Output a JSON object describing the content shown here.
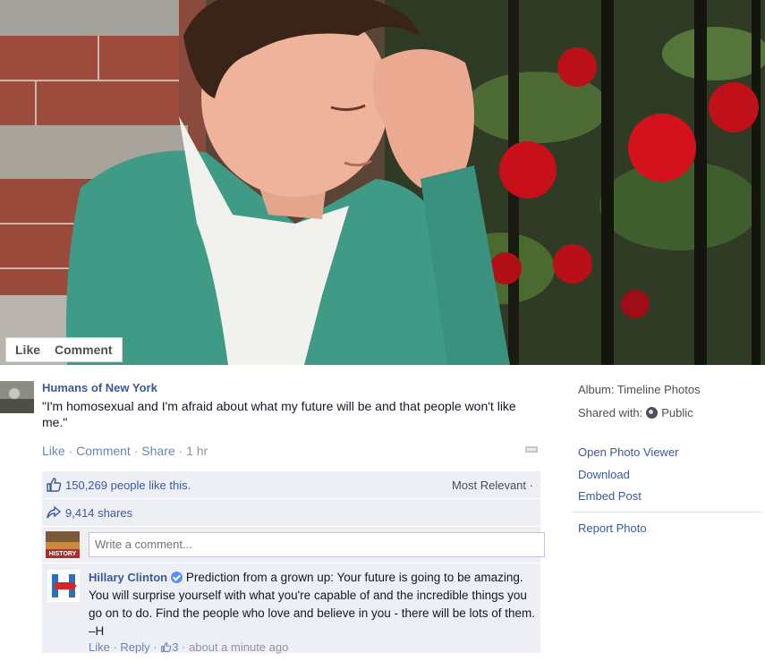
{
  "photo": {
    "like_label": "Like",
    "comment_label": "Comment"
  },
  "post": {
    "author": "Humans of New York",
    "text": "\"I'm homosexual and I'm afraid about what my future will be and that people won't like me.\"",
    "actions": {
      "like": "Like",
      "comment": "Comment",
      "share": "Share",
      "time": "1 hr"
    }
  },
  "ufi": {
    "likes_text": "150,269 people like this.",
    "sort_label": "Most Relevant",
    "shares_text": "9,414 shares",
    "comment_placeholder": "Write a comment...",
    "me_avatar_text": "HISTORY"
  },
  "comment": {
    "author": "Hillary Clinton",
    "text": "Prediction from a grown up: Your future is going to be amazing. You will surprise yourself with what you're capable of and the incredible things you go on to do. Find the people who love and believe in you - there will be lots of them. –H",
    "like": "Like",
    "reply": "Reply",
    "like_count": "3",
    "time": "about a minute ago"
  },
  "sidebar": {
    "album": "Album: Timeline Photos",
    "shared_with_label": "Shared with:",
    "shared_with_value": "Public",
    "links": {
      "open_viewer": "Open Photo Viewer",
      "download": "Download",
      "embed": "Embed Post",
      "report": "Report Photo"
    }
  },
  "colors": {
    "link": "#3b5998",
    "ufi_bg": "#edeff4",
    "verified": "#5890ff"
  }
}
